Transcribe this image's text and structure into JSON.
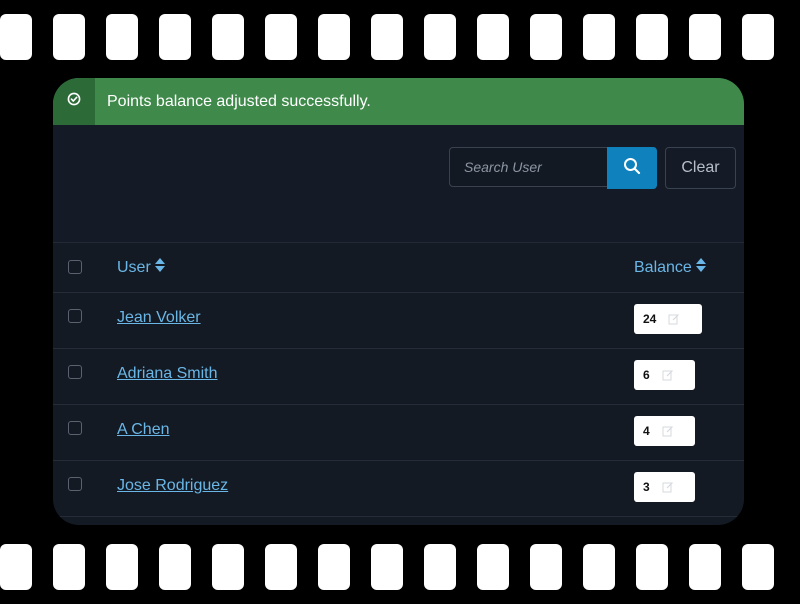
{
  "alert": {
    "icon": "check-circle-icon",
    "message": "Points balance adjusted successfully.",
    "color": "#3f8a4b"
  },
  "search": {
    "placeholder": "Search User",
    "value": "",
    "button_icon": "search-icon",
    "clear_label": "Clear"
  },
  "table": {
    "columns": [
      {
        "label": "User",
        "sort_icon": "sort-icon"
      },
      {
        "label": "Balance",
        "sort_icon": "sort-icon"
      }
    ],
    "rows": [
      {
        "user": "Jean Volker",
        "balance": "24"
      },
      {
        "user": "Adriana Smith",
        "balance": "6"
      },
      {
        "user": "A Chen",
        "balance": "4"
      },
      {
        "user": "Jose Rodriguez",
        "balance": "3"
      }
    ]
  },
  "colors": {
    "accent": "#0f82bd",
    "link": "#6ab6e6",
    "panel_bg": "#141a24"
  }
}
